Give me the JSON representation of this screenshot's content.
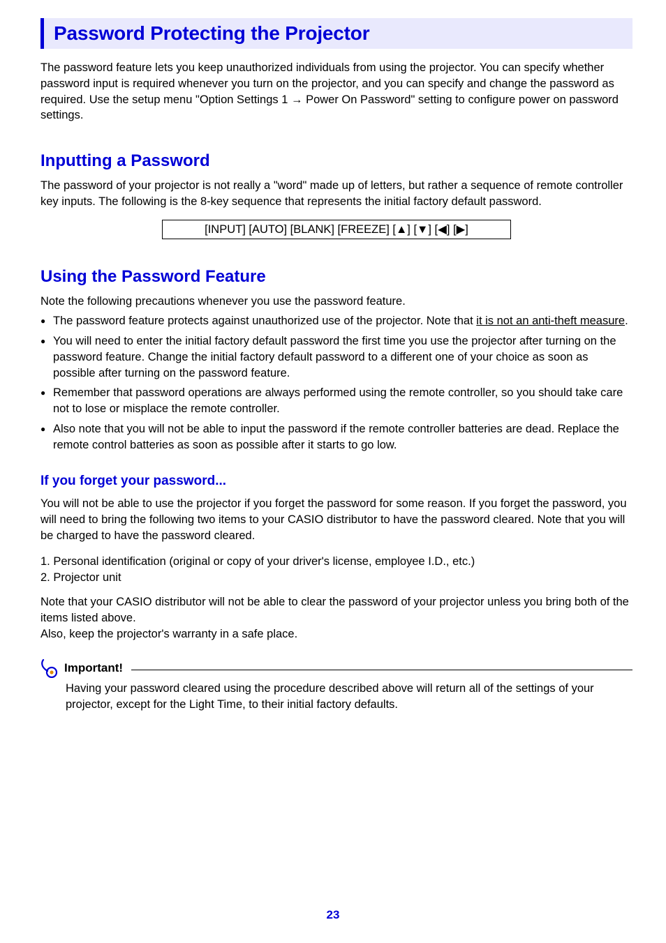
{
  "title": "Password Protecting the Projector",
  "intro": "The password feature lets you keep unauthorized individuals from using the projector. You can specify whether password input is required whenever you turn on the projector, and you can specify and change the password as required. Use the setup menu \"Option Settings 1 → Power On Password\" setting to configure power on password settings.",
  "section1": {
    "heading": "Inputting a Password",
    "text": "The password of your projector is not really a \"word\" made up of letters, but rather a sequence of remote controller key inputs. The following is the 8-key sequence that represents the initial factory default password.",
    "keys": "[INPUT] [AUTO] [BLANK] [FREEZE] [▲] [▼] [◀] [▶]"
  },
  "section2": {
    "heading": "Using the Password Feature",
    "lead": "Note the following precautions whenever you use the password feature.",
    "b1_pre": "The password feature protects against unauthorized use of the projector. Note that ",
    "b1_u": "it is not an anti-theft measure",
    "b1_post": ".",
    "b2": "You will need to enter the initial factory default password the first time you use the projector after turning on the password feature. Change the initial factory default password to a different one of your choice as soon as possible after turning on the password feature.",
    "b3": "Remember that password operations are always performed using the remote controller, so you should take care not to lose or misplace the remote controller.",
    "b4": "Also note that you will not be able to input the password if the remote controller batteries are dead. Replace the remote control batteries as soon as possible after it starts to go low."
  },
  "section3": {
    "heading": "If you forget your password...",
    "p1": "You will not be able to use the projector if you forget the password for some reason. If you forget the password, you will need to bring the following two items to your CASIO distributor to have the password cleared. Note that you will be charged to have the password cleared.",
    "item1": "1. Personal identification (original or copy of your driver's license, employee I.D., etc.)",
    "item2": "2. Projector unit",
    "p2": "Note that your CASIO distributor will not be able to clear the password of your projector unless you bring both of the items listed above.",
    "p3": "Also, keep the projector's warranty in a safe place."
  },
  "important": {
    "label": "Important!",
    "text": "Having your password cleared using the procedure described above will return all of the settings of your projector, except for the Light Time, to their initial factory defaults."
  },
  "page_number": "23"
}
